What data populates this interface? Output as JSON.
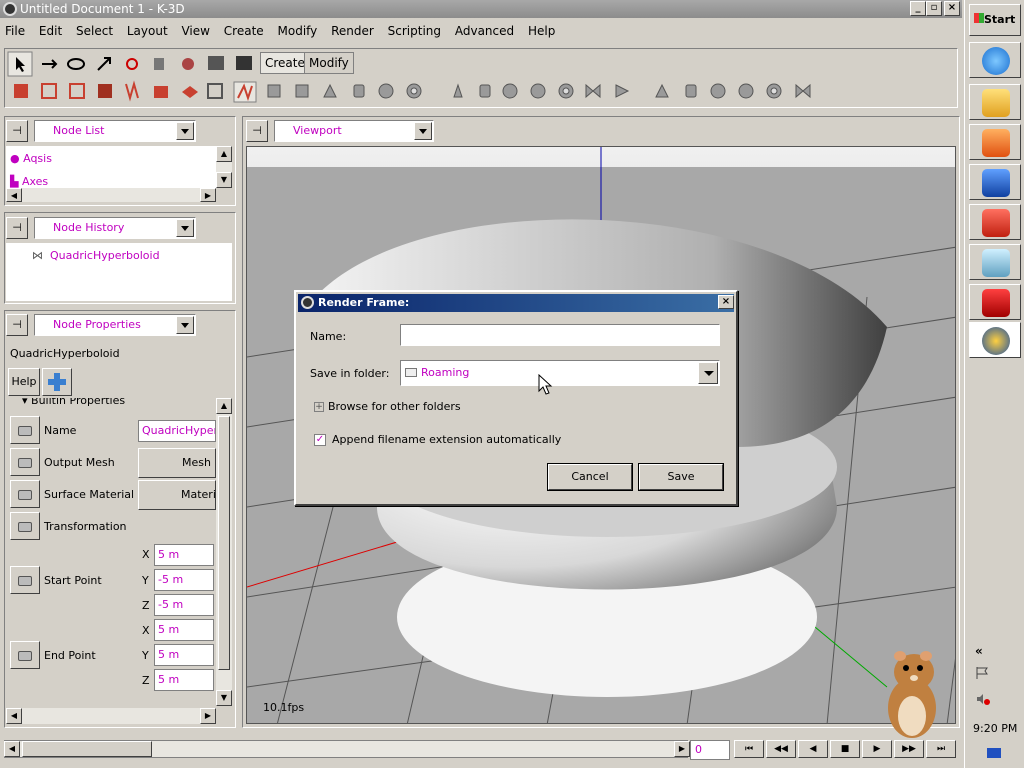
{
  "window": {
    "title": "Untitled Document 1 - K-3D"
  },
  "menu": [
    "File",
    "Edit",
    "Select",
    "Layout",
    "View",
    "Create",
    "Modify",
    "Render",
    "Scripting",
    "Advanced",
    "Help"
  ],
  "toolbar": {
    "tabs": [
      "Create",
      "Modify"
    ]
  },
  "node_list": {
    "combo": "Node List",
    "items": [
      "Aqsis",
      "Axes"
    ]
  },
  "node_history": {
    "combo": "Node History",
    "items": [
      "QuadricHyperboloid"
    ]
  },
  "node_properties": {
    "combo": "Node Properties",
    "node_name": "QuadricHyperboloid",
    "help_label": "Help",
    "section": "Builtin Properties",
    "props": {
      "name_label": "Name",
      "name_value": "QuadricHyperboloid",
      "output_mesh_label": "Output Mesh",
      "output_mesh_value": "Mesh",
      "surface_material_label": "Surface Material",
      "surface_material_value": "Material",
      "transformation_label": "Transformation",
      "start_point_label": "Start Point",
      "start": {
        "x": "5 m",
        "y": "-5 m",
        "z": "-5 m"
      },
      "end_point_label": "End Point",
      "end": {
        "x": "5 m",
        "y": "5 m",
        "z": "5 m"
      },
      "axis_x": "X",
      "axis_y": "Y",
      "axis_z": "Z"
    }
  },
  "viewport": {
    "combo": "Viewport",
    "fps": "10.1fps"
  },
  "dialog": {
    "title": "Render Frame:",
    "name_label": "Name:",
    "name_value": "",
    "folder_label": "Save in folder:",
    "folder_value": "Roaming",
    "browse_label": "Browse for other folders",
    "append_label": "Append filename extension automatically",
    "append_checked": true,
    "cancel_label": "Cancel",
    "save_label": "Save"
  },
  "timeline": {
    "frame": "0"
  },
  "taskbar": {
    "start_label": "Start",
    "clock": "9:20 PM",
    "collapse": "«"
  }
}
